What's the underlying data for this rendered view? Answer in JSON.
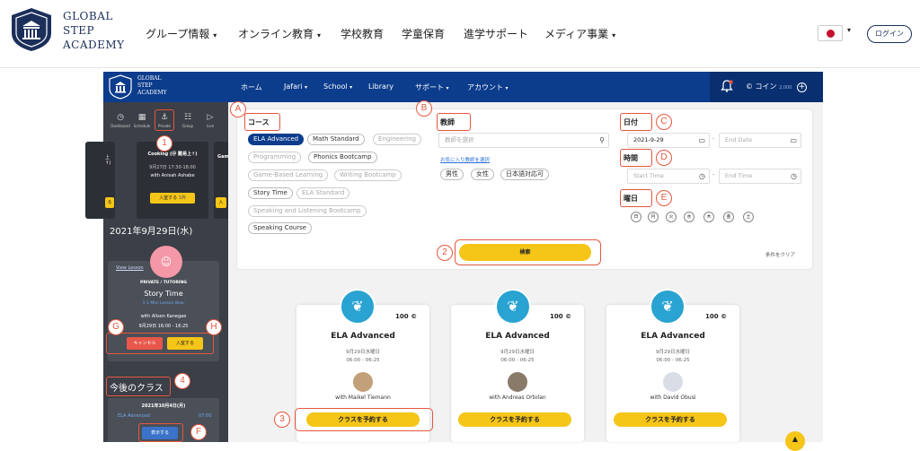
{
  "site": {
    "logo": {
      "line1": "GLOBAL",
      "line2": "STEP",
      "line3": "ACADEMY"
    },
    "nav": [
      {
        "label": "グループ情報",
        "dropdown": true
      },
      {
        "label": "オンライン教育",
        "dropdown": true
      },
      {
        "label": "学校教育",
        "dropdown": false
      },
      {
        "label": "学童保育",
        "dropdown": false
      },
      {
        "label": "進学サポート",
        "dropdown": false
      },
      {
        "label": "メディア事業",
        "dropdown": true
      }
    ],
    "caret": "▾",
    "language_flag": "japan-flag-icon",
    "login_label": "ログイン"
  },
  "app": {
    "logo": {
      "line1": "GLOBAL",
      "line2": "STEP",
      "line3": "ACADEMY"
    },
    "nav": [
      {
        "label": "ホーム",
        "caret": ""
      },
      {
        "label": "Jafari",
        "caret": "▾"
      },
      {
        "label": "School",
        "caret": "▾"
      },
      {
        "label": "Library",
        "caret": ""
      },
      {
        "label": "サポート",
        "caret": "▾"
      },
      {
        "label": "アカウント",
        "caret": "▾"
      }
    ],
    "coin_label": "コイン",
    "coin_amount": "2,000",
    "notification_dot_color": "#e5573f",
    "brand_color": "#0c3c8c",
    "accent_color": "#f5c518"
  },
  "sidebar": {
    "icons": [
      {
        "label": "Dashboard",
        "icon": "dashboard-icon"
      },
      {
        "label": "Schedule",
        "icon": "schedule-icon"
      },
      {
        "label": "Private",
        "icon": "private-icon"
      },
      {
        "label": "Group",
        "icon": "group-icon"
      },
      {
        "label": "Live",
        "icon": "live-icon"
      }
    ],
    "carousel": {
      "left_partial": {
        "title": "上↑)",
        "button": "る"
      },
      "center": {
        "title": "Cooking (＠ 難易上↑)",
        "time": "9月27日 17:30-18:00",
        "teacher": "with Anisah Ashabe",
        "button": "入室する",
        "button_extra": "1枠"
      },
      "right_partial": {
        "title": "Gam",
        "button": "入"
      }
    },
    "date_heading": "2021年9月29日(水)",
    "booking": {
      "view_link": "View Lesson",
      "type": "PRIVATE / TUTORING",
      "title": "Story Time",
      "subtitle": "1-1 Mini Lesson Bear",
      "teacher": "with Alison Kanegae",
      "time": "9月29日 16:00 - 16:25",
      "cancel_label": "キャンセル",
      "enter_label": "入室する"
    },
    "upcoming_heading": "今後のクラス",
    "upcoming": {
      "date": "2021年10月4日(月)",
      "course": "ELA Advanced",
      "time": "07:00",
      "show_label": "表示する"
    }
  },
  "filters": {
    "course": {
      "label": "コース",
      "options": [
        {
          "label": "ELA Advanced",
          "state": "active"
        },
        {
          "label": "Math Standard",
          "state": "normal"
        },
        {
          "label": "Engineering",
          "state": "dim"
        },
        {
          "label": "Programming",
          "state": "dim"
        },
        {
          "label": "Phonics Bootcamp",
          "state": "normal"
        },
        {
          "label": "Game-Based Learning",
          "state": "dim"
        },
        {
          "label": "Writing Bootcamp",
          "state": "dim"
        },
        {
          "label": "Story Time",
          "state": "normal"
        },
        {
          "label": "ELA Standard",
          "state": "dim"
        },
        {
          "label": "Speaking and Listening Bootcamp",
          "state": "dim"
        },
        {
          "label": "Speaking Course",
          "state": "normal"
        }
      ]
    },
    "teacher": {
      "label": "教師",
      "placeholder": "教師を選択",
      "favorites_link": "お気に入り教師を選択",
      "options": [
        "男性",
        "女性",
        "日本語対応可"
      ]
    },
    "date": {
      "label": "日付",
      "start_value": "2021-9-29",
      "end_placeholder": "End Date"
    },
    "time": {
      "label": "時間",
      "start_placeholder": "Start Time",
      "end_placeholder": "End Time"
    },
    "weekday": {
      "label": "曜日",
      "days": [
        "日",
        "月",
        "火",
        "水",
        "木",
        "金",
        "土"
      ]
    },
    "search_label": "検索",
    "clear_label": "条件をクリア",
    "range_separator": "-"
  },
  "courses": [
    {
      "coins": "100",
      "title": "ELA Advanced",
      "date": "9月29日水曜日",
      "time": "06:00 - 06:25",
      "teacher": "with Maikel Tiemann",
      "button": "クラスを予約する"
    },
    {
      "coins": "100",
      "title": "ELA Advanced",
      "date": "9月29日水曜日",
      "time": "06:00 - 06:25",
      "teacher": "with Andreas Ortolan",
      "button": "クラスを予約する"
    },
    {
      "coins": "100",
      "title": "ELA Advanced",
      "date": "9月29日水曜日",
      "time": "06:00 - 06:25",
      "teacher": "with David Obusi",
      "button": "クラスを予約する"
    }
  ],
  "coin_symbol": "©",
  "annotations": {
    "n1": "1",
    "n2": "2",
    "n3": "3",
    "n4": "4",
    "A": "A",
    "B": "B",
    "C": "C",
    "D": "D",
    "E": "E",
    "F": "F",
    "G": "G",
    "H": "H"
  },
  "annotation_color": "#e5573f"
}
